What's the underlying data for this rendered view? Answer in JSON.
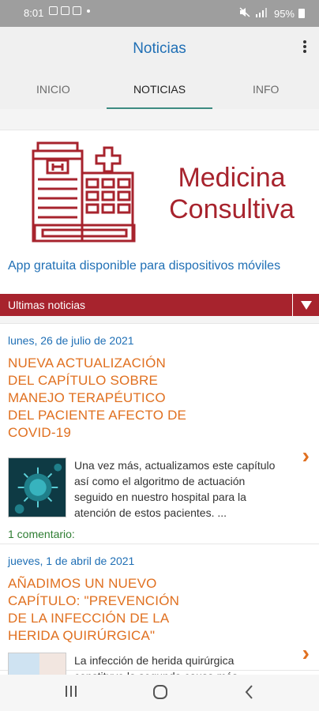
{
  "status_bar": {
    "time": "8:01",
    "battery": "95%"
  },
  "app_bar": {
    "title": "Noticias",
    "menu_icon": "more-vert-icon"
  },
  "tabs": [
    {
      "label": "INICIO",
      "active": false
    },
    {
      "label": "NOTICIAS",
      "active": true
    },
    {
      "label": "INFO",
      "active": false
    }
  ],
  "banner": {
    "brand_line1": "Medicina",
    "brand_line2": "Consultiva",
    "tagline": "App gratuita disponible para dispositivos móviles",
    "logo_icon": "hospital-icon"
  },
  "section": {
    "label": "Ultimas noticias",
    "toggle_icon": "triangle-down-icon"
  },
  "posts": [
    {
      "date": "lunes, 26 de julio de 2021",
      "title": "NUEVA ACTUALIZACIÓN DEL CAPÍTULO SOBRE MANEJO TERAPÉUTICO DEL PACIENTE AFECTO DE COVID-19",
      "excerpt": "Una vez más, actualizamos este capítulo así como el algoritmo de actuación seguido en nuestro hospital para la atención de estos pacientes. ...",
      "comments": "1 comentario:",
      "thumbnail": "virus-thumbnail"
    },
    {
      "date": "jueves, 1 de abril de 2021",
      "title": "AÑADIMOS UN NUEVO CAPÍTULO: \"PREVENCIÓN DE LA INFECCIÓN DE LA HERIDA QUIRÚRGICA\"",
      "excerpt": "La infección de herida quirúrgica constituye la segunda causa más",
      "thumbnail": "surgery-thumbnail"
    }
  ],
  "colors": {
    "brand_red": "#a7232d",
    "link_blue": "#1f6fb5",
    "title_orange": "#e07020",
    "comment_green": "#2e7d32",
    "tab_indicator": "#3d8b82"
  }
}
